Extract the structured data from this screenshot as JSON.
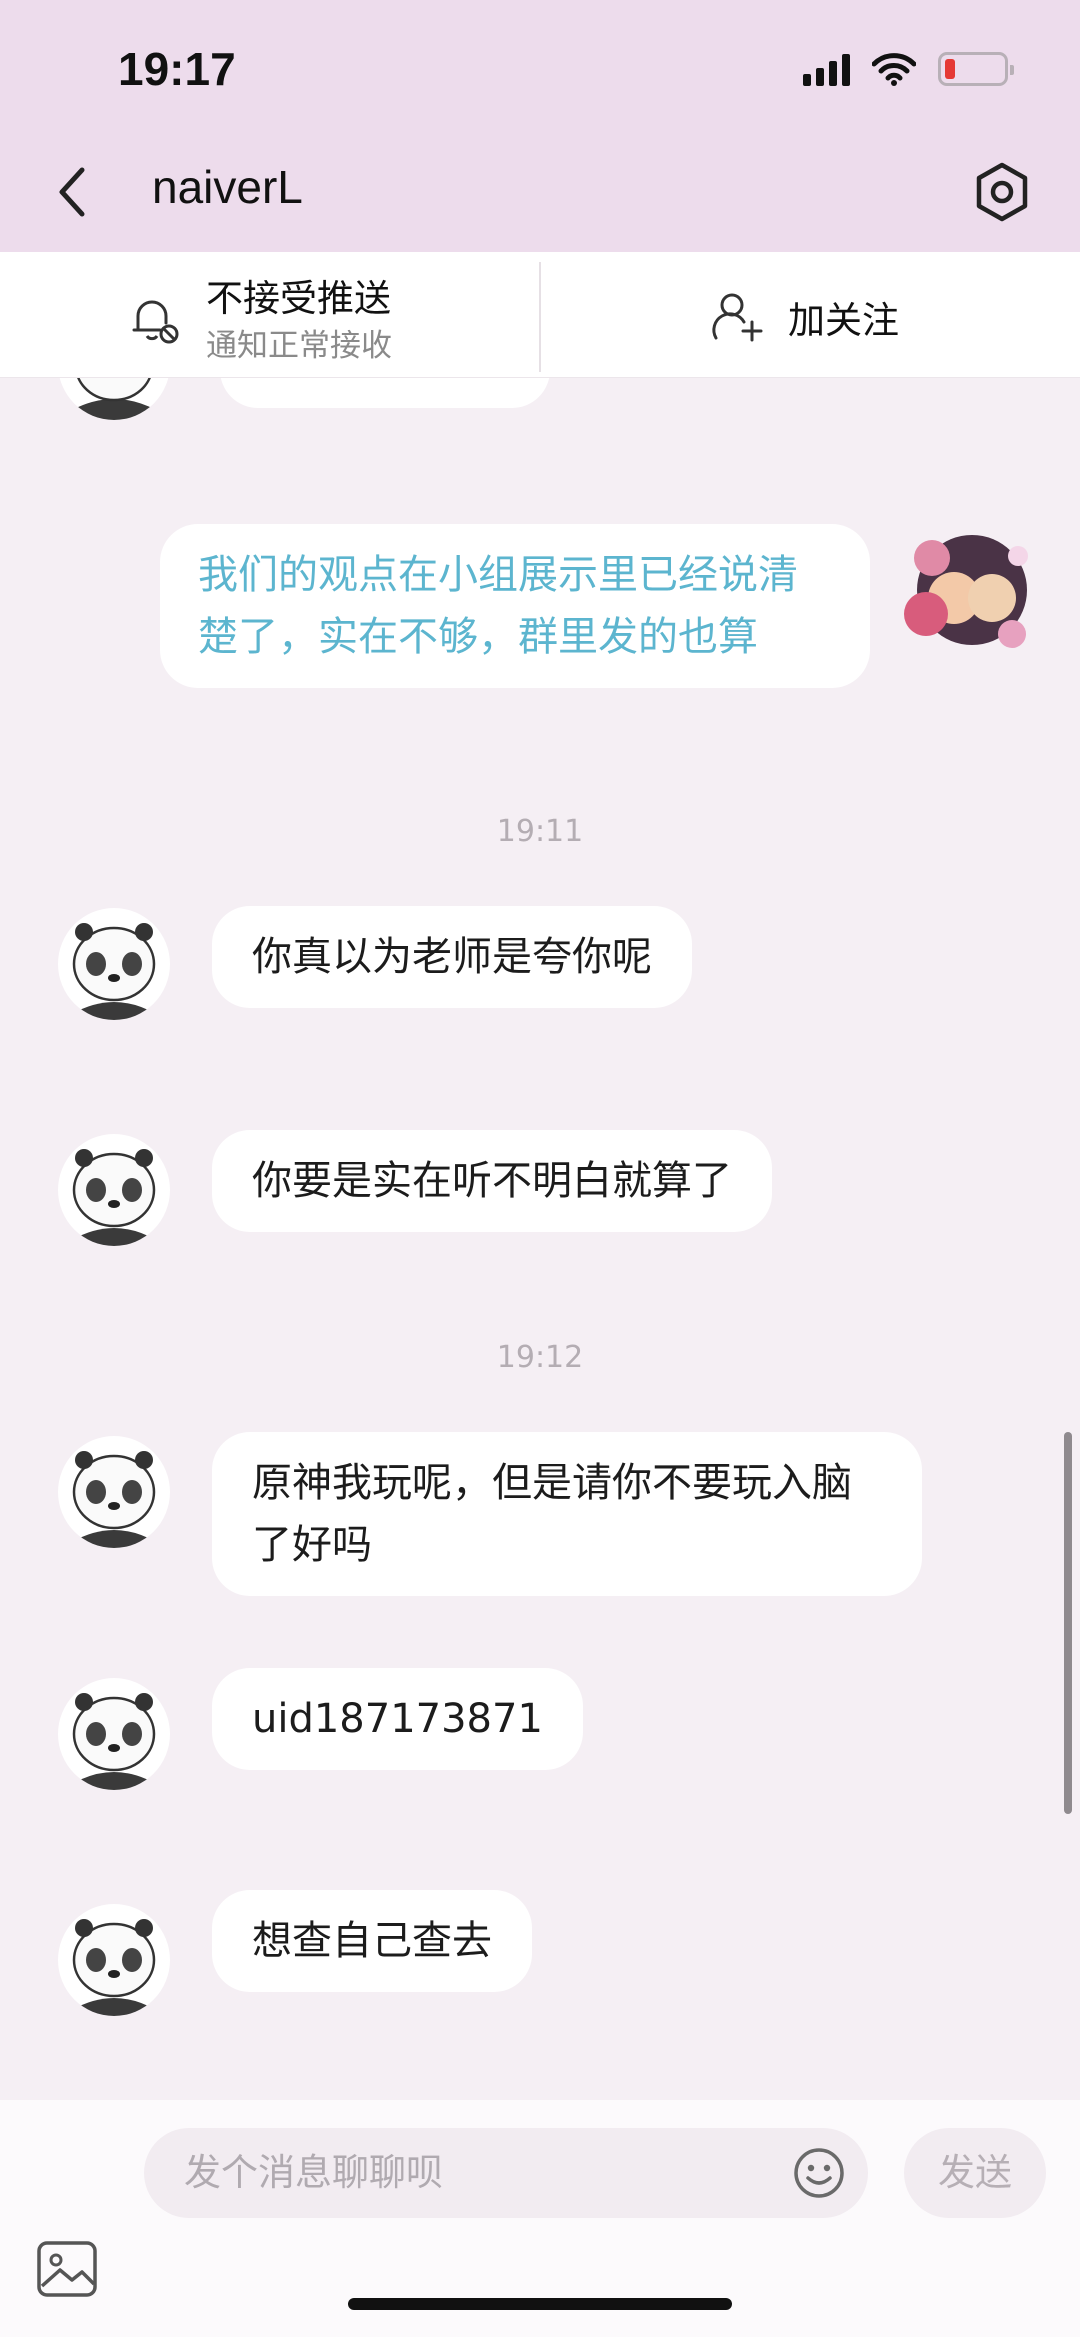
{
  "status_bar": {
    "time": "19:17"
  },
  "header": {
    "title": "naiverL"
  },
  "action_bar": {
    "push_title": "不接受推送",
    "push_subtitle": "通知正常接收",
    "follow_label": "加关注"
  },
  "messages": [
    {
      "sender": "self",
      "text": "我们的观点在小组展示里已经说清楚了，实在不够，群里发的也算"
    },
    {
      "type": "timestamp",
      "text": "19:11"
    },
    {
      "sender": "other",
      "text": "你真以为老师是夸你呢"
    },
    {
      "sender": "other",
      "text": "你要是实在听不明白就算了"
    },
    {
      "type": "timestamp",
      "text": "19:12"
    },
    {
      "sender": "other",
      "text": "原神我玩呢，但是请你不要玩入脑了好吗"
    },
    {
      "sender": "other",
      "text": "uid187173871"
    },
    {
      "sender": "other",
      "text": "想查自己查去"
    }
  ],
  "input": {
    "placeholder": "发个消息聊聊呗",
    "send_label": "发送"
  },
  "colors": {
    "header_bg": "#eddcec",
    "chat_bg": "#f5eff4",
    "self_text": "#5cb5cf"
  }
}
